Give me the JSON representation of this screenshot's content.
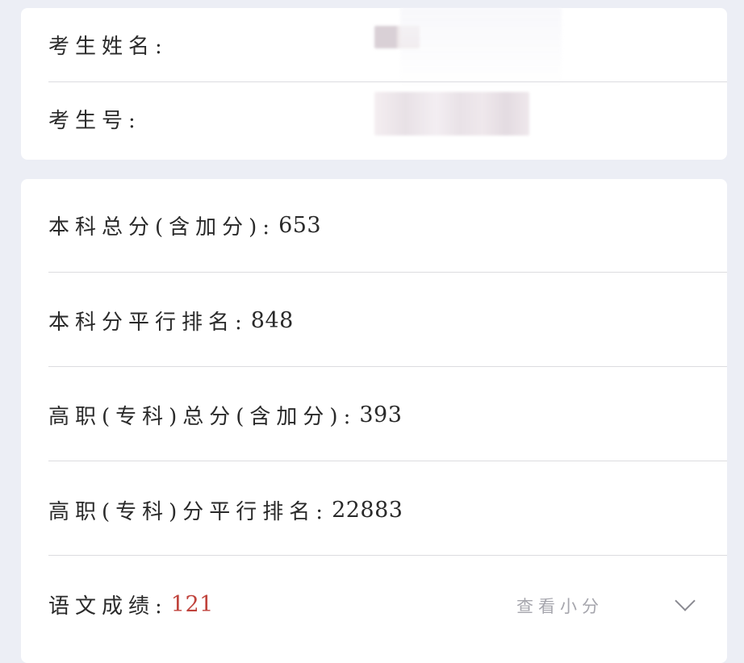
{
  "student": {
    "name_label": "考生姓名:",
    "id_label": "考生号:"
  },
  "scores": {
    "benke_total_label": "本科总分(含加分):",
    "benke_total_value": "653",
    "benke_rank_label": "本科分平行排名:",
    "benke_rank_value": "848",
    "gaozhi_total_label": "高职(专科)总分(含加分):",
    "gaozhi_total_value": "393",
    "gaozhi_rank_label": "高职(专科)分平行排名:",
    "gaozhi_rank_value": "22883",
    "chinese_label": "语文成绩:",
    "chinese_value": "121",
    "view_detail_label": "查看小分"
  },
  "colors": {
    "page_background": "#eceef5",
    "card_background": "#ffffff",
    "score_highlight": "#c0433c",
    "muted_link": "#a6a6ad"
  }
}
